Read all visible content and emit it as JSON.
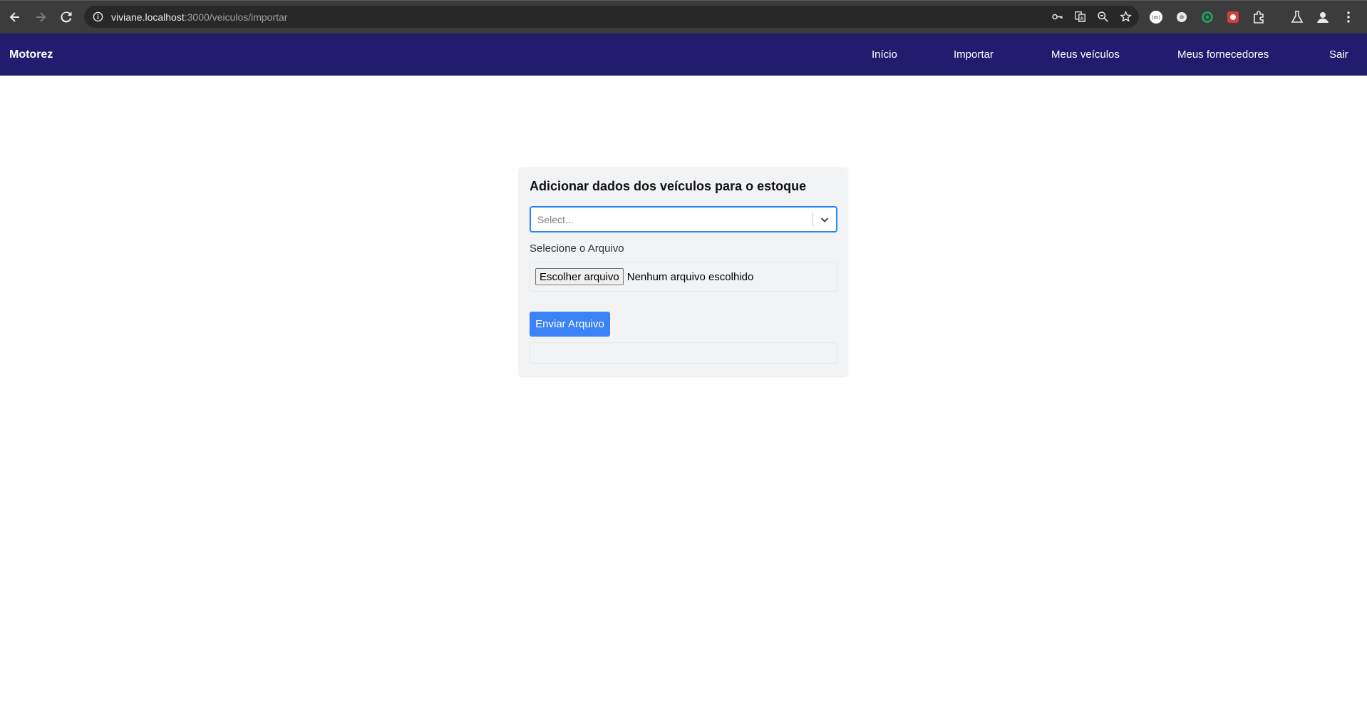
{
  "browser": {
    "url_host": "viviane.localhost",
    "url_path": ":3000/veiculos/importar",
    "icons": [
      "back-icon",
      "forward-icon",
      "reload-icon",
      "site-info-icon",
      "password-key-icon",
      "translate-icon",
      "zoom-icon",
      "bookmark-star-icon",
      "extension-icon",
      "labs-icon",
      "profile-icon",
      "menu-dots-icon"
    ]
  },
  "nav": {
    "brand": "Motorez",
    "items": [
      {
        "label": "Início"
      },
      {
        "label": "Importar"
      },
      {
        "label": "Meus veículos"
      },
      {
        "label": "Meus fornecedores"
      },
      {
        "label": "Sair"
      }
    ],
    "background": "#221c6e"
  },
  "card": {
    "title": "Adicionar dados dos veículos para o estoque",
    "select_placeholder": "Select...",
    "file_label": "Selecione o Arquivo",
    "file_button": "Escolher arquivo",
    "file_status": "Nenhum arquivo escolhido",
    "submit_label": "Enviar Arquivo",
    "accent": "#3b82f6"
  }
}
